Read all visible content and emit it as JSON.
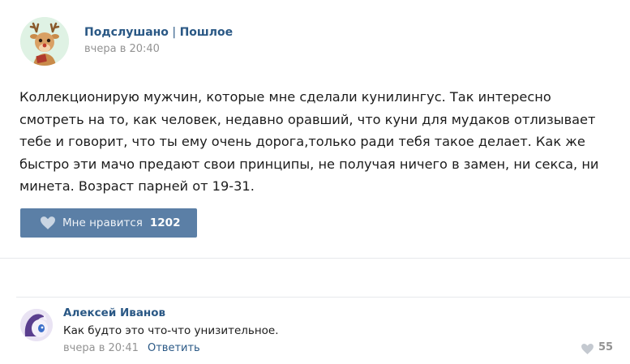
{
  "post": {
    "author": "Подслушано",
    "author_sep": " | ",
    "author_sub": "Пошлое",
    "time": "вчера в 20:40",
    "text": "Коллекционирую мужчин, которые мне сделали кунилингус. Так интересно смотреть на то, как человек, недавно оравший, что куни для мудаков отлизывает тебе и говорит, что ты ему очень дорога,только ради тебя такое делает. Как же быстро эти мачо предают свои принципы, не получая ничего в замен, ни секса, ни минета. Возраст парней от 19-31.",
    "like_label": "Мне нравится",
    "like_count": "1202"
  },
  "comment": {
    "author": "Алексей Иванов",
    "text": "Как будто это что-что унизительное.",
    "time": "вчера в 20:41",
    "reply_label": "Ответить",
    "like_count": "55"
  },
  "colors": {
    "link": "#2a5885",
    "button_bg": "#5b7fa6",
    "muted": "#939393"
  }
}
